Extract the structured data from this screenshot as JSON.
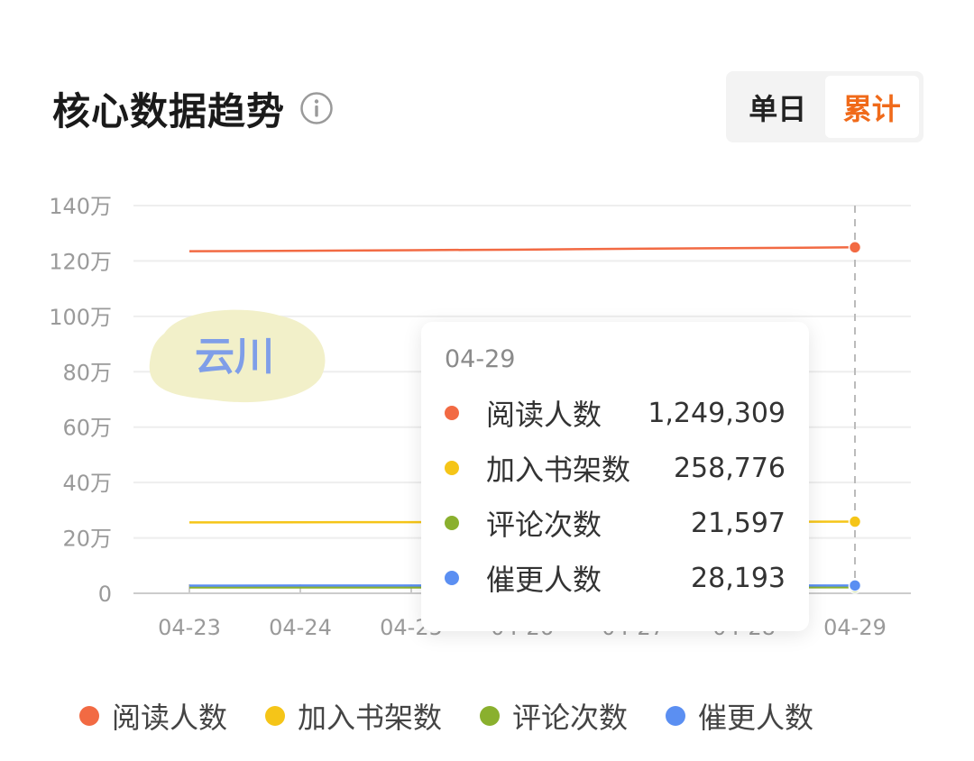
{
  "header": {
    "title": "核心数据趋势"
  },
  "toggle": {
    "options": [
      "单日",
      "累计"
    ],
    "active_index": 1
  },
  "colors": {
    "reads": "#f26a43",
    "shelf": "#f5c518",
    "comments": "#8ab02e",
    "urges": "#5b8ff2",
    "accent": "#f06a1a"
  },
  "chart_data": {
    "type": "line",
    "x": [
      "04-23",
      "04-24",
      "04-25",
      "04-26",
      "04-27",
      "04-28",
      "04-29"
    ],
    "ylim": [
      0,
      1400000
    ],
    "y_ticks": [
      0,
      200000,
      400000,
      600000,
      800000,
      1000000,
      1200000,
      1400000
    ],
    "y_tick_labels": [
      "0",
      "20万",
      "40万",
      "60万",
      "80万",
      "100万",
      "120万",
      "140万"
    ],
    "grid": true,
    "legend_position": "bottom",
    "series": [
      {
        "name": "阅读人数",
        "values": [
          1235000,
          1237000,
          1239000,
          1241000,
          1244000,
          1246500,
          1249309
        ]
      },
      {
        "name": "加入书架数",
        "values": [
          256000,
          256500,
          257000,
          257500,
          258000,
          258400,
          258776
        ]
      },
      {
        "name": "评论次数",
        "values": [
          21000,
          21100,
          21200,
          21300,
          21400,
          21500,
          21597
        ]
      },
      {
        "name": "催更人数",
        "values": [
          27800,
          27900,
          27950,
          28000,
          28050,
          28120,
          28193
        ]
      }
    ]
  },
  "tooltip": {
    "date": "04-29",
    "rows": [
      {
        "label": "阅读人数",
        "value": "1,249,309"
      },
      {
        "label": "加入书架数",
        "value": "258,776"
      },
      {
        "label": "评论次数",
        "value": "21,597"
      },
      {
        "label": "催更人数",
        "value": "28,193"
      }
    ]
  },
  "sticker": {
    "text": "云川"
  }
}
